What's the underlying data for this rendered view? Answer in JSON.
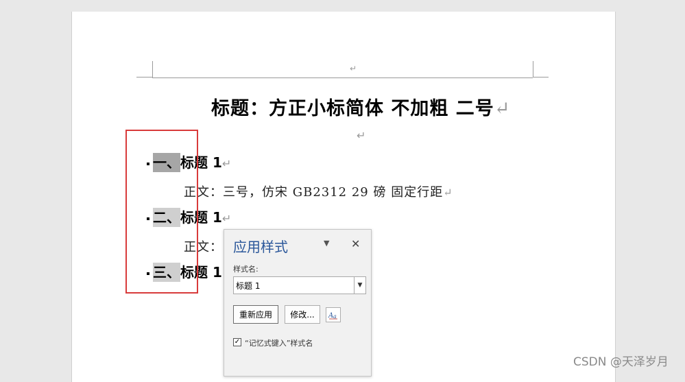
{
  "document": {
    "title_text": "标题：方正小标简体 不加粗  二号",
    "paragraph_mark": "↵",
    "headings": [
      {
        "number": "一、",
        "text": "标题 1"
      },
      {
        "number": "二、",
        "text": "标题 1"
      },
      {
        "number": "三、",
        "text": "标题 1"
      }
    ],
    "body_lines": [
      "正文：三号，仿宋 GB2312 29 磅 固定行距",
      "正文："
    ]
  },
  "styles_pane": {
    "title": "应用样式",
    "dropdown_icon": "triangle-down-icon",
    "close_icon": "close-icon",
    "style_name_label": "样式名:",
    "style_name_value": "标题 1",
    "reapply_label": "重新应用",
    "modify_label": "修改...",
    "styles_icon": "styles-icon",
    "autocomplete_label": "“记忆式键入”样式名",
    "autocomplete_checked": true
  },
  "watermark": "CSDN @天泽岁月",
  "colors": {
    "pane_title": "#2b579a",
    "annotation_box": "#d83a3a"
  }
}
